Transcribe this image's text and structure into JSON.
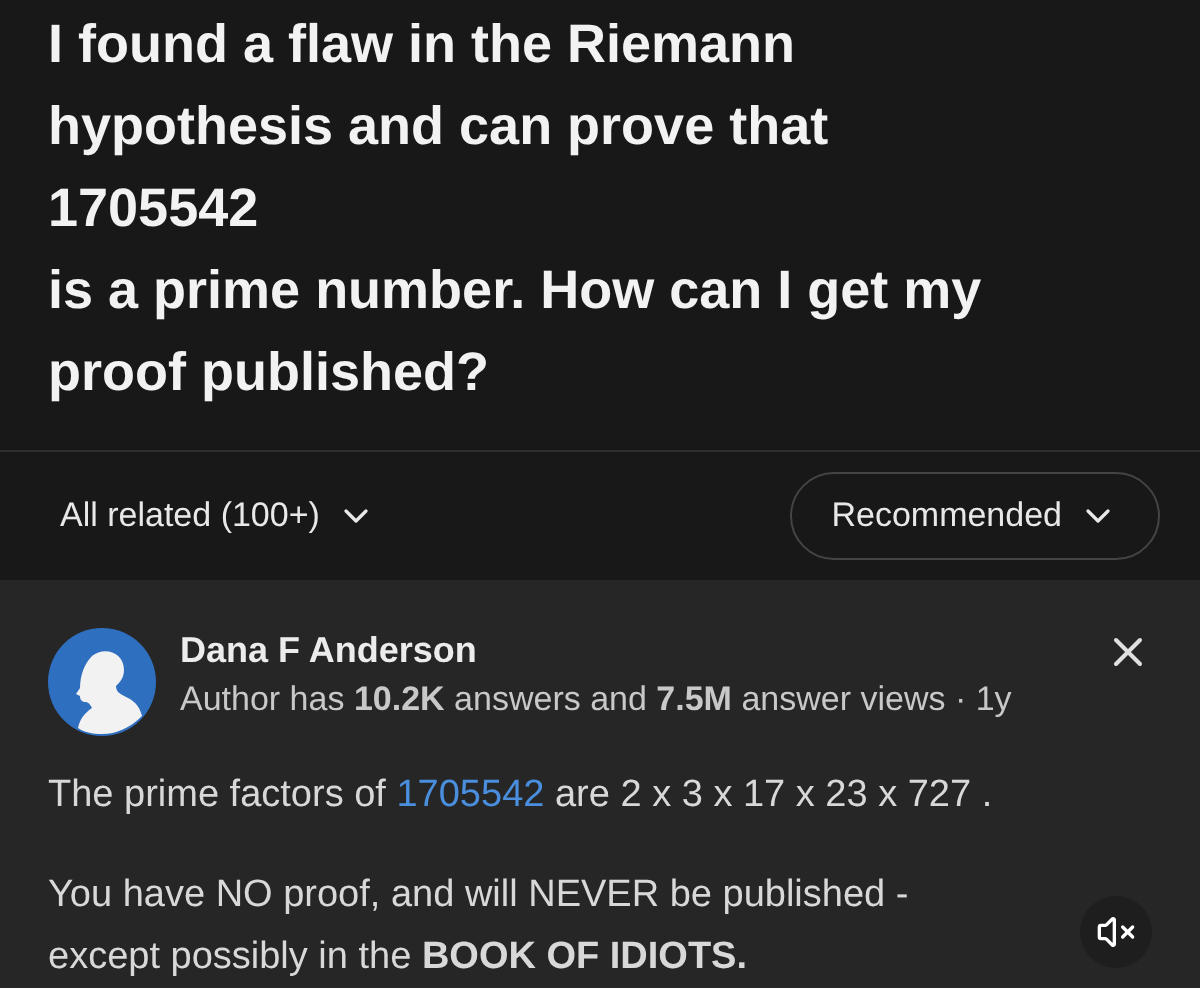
{
  "question": {
    "title": "I found a flaw in the Riemann\nhypothesis and can prove that\n1705542\nis a prime number. How can I get my\nproof published?"
  },
  "filters": {
    "related": "All related (100+)",
    "sort": "Recommended"
  },
  "answer": {
    "author": "Dana F Anderson",
    "meta": "Author has **10.2K** answers and **7.5M** answer views · 1y",
    "factors": {
      "before": "The prime factors of ",
      "link": "1705542",
      "after": " are 2 x 3 x 17 x 23 x 727 ."
    },
    "body": "You have NO proof, and will NEVER be published - except possibly in the **BOOK OF IDIOTS.**",
    "muted": true
  }
}
